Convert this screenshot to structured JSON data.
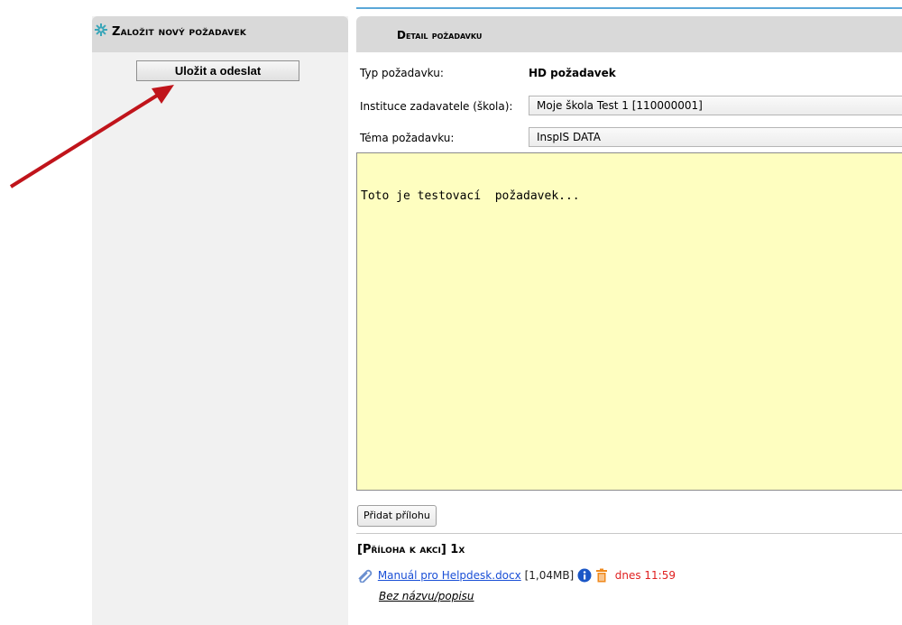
{
  "left": {
    "title": "Založit nový požadavek",
    "save_label": "Uložit a odeslat"
  },
  "detail": {
    "title": "Detail požadavku",
    "type_label": "Typ požadavku:",
    "type_value": "HD požadavek",
    "institution_label": "Instituce zadavatele (škola):",
    "institution_value": "Moje škola Test 1 [110000001]",
    "topic_label": "Téma požadavku:",
    "topic_value": "InspIS DATA",
    "body_text": "Toto je testovací  požadavek..."
  },
  "attachments": {
    "add_label": "Přidat přílohu",
    "heading": "[Příloha k akci] 1x",
    "items": [
      {
        "file_name": "Manuál pro Helpdesk.docx",
        "size": "[1,04MB]",
        "time": "dnes 11:59",
        "description": "Bez názvu/popisu"
      }
    ]
  },
  "icons": {
    "header_icon": "gear-icon",
    "paperclip": "paperclip-icon",
    "info": "info-icon",
    "trash": "trash-icon"
  },
  "colors": {
    "accent": "#5aa7d8",
    "arrow": "#c0141b",
    "textarea_bg": "#fefec0",
    "link": "#1a4fd6",
    "time": "#e02020"
  }
}
